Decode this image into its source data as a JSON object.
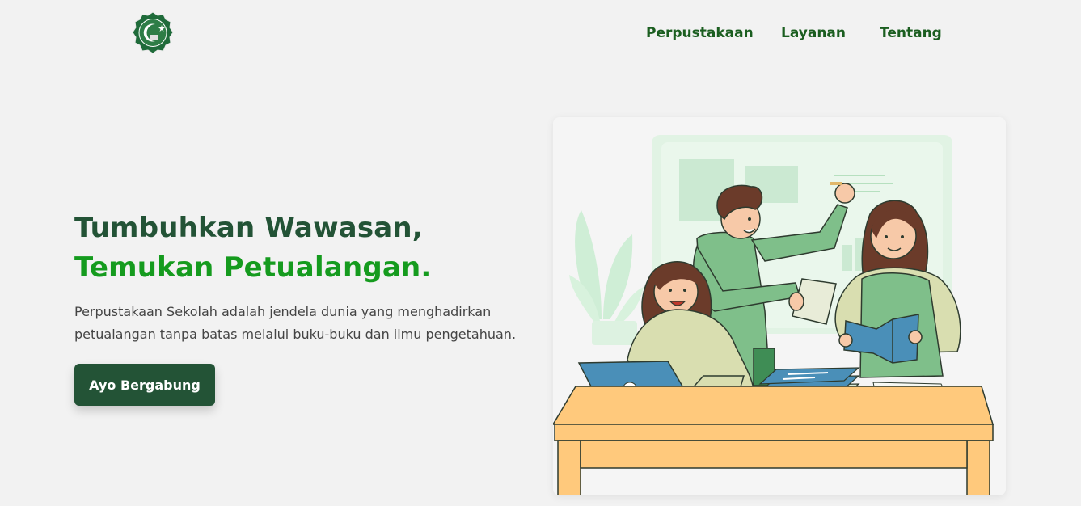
{
  "nav": {
    "logo_icon": "school-crest-logo",
    "links": [
      "Perpustakaan",
      "Layanan",
      "Tentang"
    ]
  },
  "hero": {
    "title_line1": "Tumbuhkan Wawasan,",
    "title_line2": "Temukan Petualangan.",
    "subtitle": "Perpustakaan Sekolah adalah jendela dunia yang menghadirkan petualangan tanpa batas melalui buku-buku dan ilmu pengetahuan.",
    "cta_label": "Ayo Bergabung"
  },
  "colors": {
    "background": "#f2f2f2",
    "primary_dark": "#235336",
    "accent_green": "#159b1e",
    "nav_link": "#1b5e20"
  }
}
